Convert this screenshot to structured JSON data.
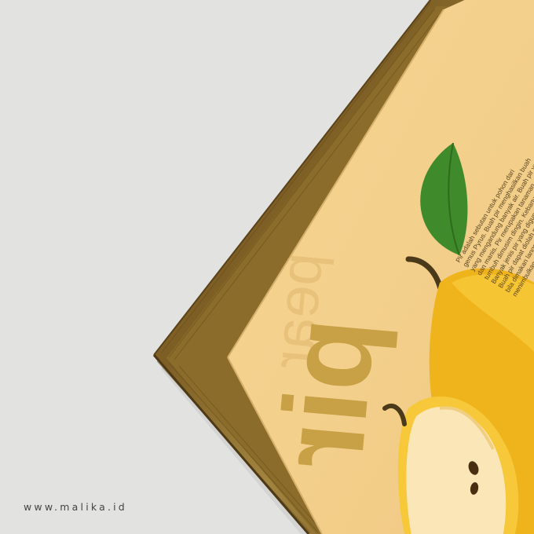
{
  "watermark": "www.malika.id",
  "poster": {
    "title": "pir",
    "subtitle": "pear",
    "description_lines": [
      "Pir adalah sebutan untuk pohon dari",
      "genus Pyrus. Buah pir menghasilkan buah",
      "yang mengandung banyak air. Buah pir yang",
      "dan manis. Pir merupakan tanaman",
      "tumbuh dimusim dingin. Kebanyakan orang",
      "Banyak jenis pir yang digunakan dalam",
      "Buah pir dapat diolah menjadi berbagai",
      "bila dimakan langsung buah pir",
      "menimbulkan rasa kembung."
    ]
  },
  "colors": {
    "background": "#e2e2e1",
    "frame_wood": "#8a6a2c",
    "frame_dark": "#4e3915",
    "poster_paper": "#f4d18f",
    "title_color": "#c8a045",
    "subtitle_color": "#e6bd70",
    "pear_yellow": "#efb31c",
    "pear_light": "#f7c93a",
    "pear_flesh": "#fbe6b8",
    "leaf_green": "#3f8a2b",
    "stem_brown": "#4a3a1a",
    "text_dark": "#5a4523"
  }
}
